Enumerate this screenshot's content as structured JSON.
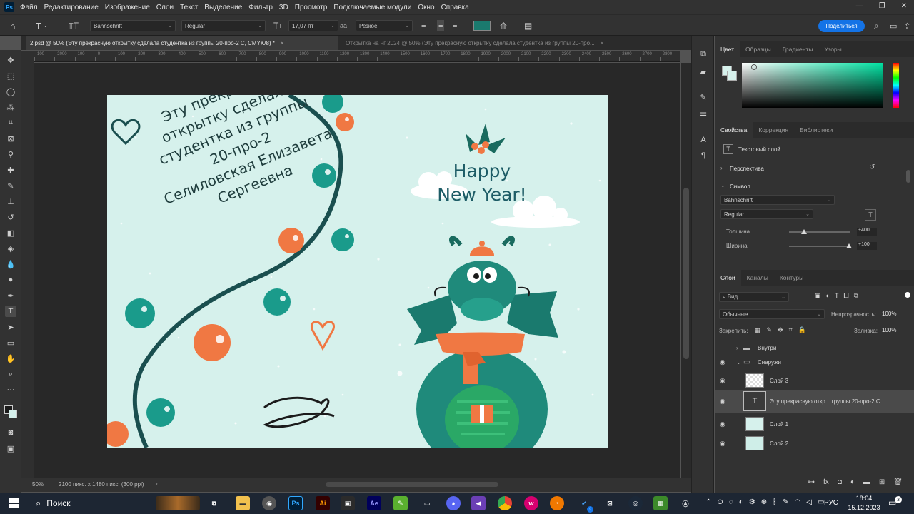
{
  "app": {
    "logo": "Ps",
    "menu": [
      "Файл",
      "Редактирование",
      "Изображение",
      "Слои",
      "Текст",
      "Выделение",
      "Фильтр",
      "3D",
      "Просмотр",
      "Подключаемые модули",
      "Окно",
      "Справка"
    ],
    "window_controls": [
      "—",
      "❐",
      "✕"
    ]
  },
  "options_bar": {
    "font_family": "Bahnschrift",
    "font_style": "Regular",
    "font_size": "17,07 пт",
    "antialias_label": "aa",
    "antialias": "Резкое",
    "text_color": "#1a7a6e",
    "share_label": "Поделиться"
  },
  "tabs": [
    {
      "label": "2.psd @ 50% (Эту прекрасную открытку сделала студентка из группы 20-про-2  С, CMYK/8) *",
      "close": "×"
    },
    {
      "label": "Открытка на нг 2024 @ 50% (Эту прекрасную открытку сделала студентка из группы 20-про...",
      "close": "×"
    }
  ],
  "ruler_top_labels": [
    "100",
    "2000",
    "100",
    "0",
    "100",
    "200",
    "300",
    "400",
    "500",
    "600",
    "700",
    "800",
    "900",
    "1000",
    "1100",
    "1200",
    "1300",
    "1400",
    "1500",
    "1600",
    "1700",
    "1800",
    "1900",
    "2000",
    "2100",
    "2200",
    "2300",
    "2400",
    "2500",
    "2600",
    "2700",
    "2800"
  ],
  "card": {
    "text_lines": [
      "Эту прекрасную",
      "открытку сделала",
      "студентка из группы",
      "20-про-2",
      "Селиловская Елизавета",
      "Сергеевна"
    ],
    "greeting_line1": "Happy",
    "greeting_line2": "New Year!",
    "colors": {
      "bg": "#d6f1ec",
      "teal": "#1a9b8b",
      "dark": "#1a4f4f",
      "orange": "#f07843"
    }
  },
  "status": {
    "zoom": "50%",
    "doc_info": "2100 пикс. x 1480 пикс. (300 ppi)",
    "arrow": "›"
  },
  "color_panel": {
    "tabs": [
      "Цвет",
      "Образцы",
      "Градиенты",
      "Узоры"
    ]
  },
  "properties_panel": {
    "tabs": [
      "Свойства",
      "Коррекция",
      "Библиотеки"
    ],
    "layer_type": "Текстовый слой",
    "section_perspective": "Перспектива",
    "section_symbol": "Символ",
    "font_family": "Bahnschrift",
    "font_style": "Regular",
    "weight_label": "Толщина",
    "weight_value": "+400",
    "width_label": "Ширина",
    "width_value": "+100"
  },
  "layers_panel": {
    "tabs": [
      "Слои",
      "Каналы",
      "Контуры"
    ],
    "filter_label": "Вид",
    "blend_mode": "Обычные",
    "opacity_label": "Непрозрачность:",
    "opacity_value": "100%",
    "lock_label": "Закрепить:",
    "fill_label": "Заливка:",
    "fill_value": "100%",
    "layers": [
      {
        "name": "Внутри",
        "kind": "group",
        "visible": false,
        "selected": false
      },
      {
        "name": "Снаружи",
        "kind": "group",
        "visible": true,
        "selected": false
      },
      {
        "name": "Слой 3",
        "kind": "pixel",
        "visible": true,
        "selected": false
      },
      {
        "name": "Эту прекрасную откр... группы 20-про-2  С",
        "kind": "text",
        "visible": true,
        "selected": true
      },
      {
        "name": "Слой 1",
        "kind": "pixel",
        "visible": true,
        "selected": false
      },
      {
        "name": "Слой 2",
        "kind": "pixel",
        "visible": true,
        "selected": false
      }
    ]
  },
  "taskbar": {
    "search_label": "Поиск",
    "language": "РУС",
    "time": "18:04",
    "date": "15.12.2023",
    "notification_count": "3",
    "badge": "9",
    "icon_labels": {
      "photoshop": "Ps",
      "illustrator": "Ai",
      "after_effects": "Ae"
    }
  }
}
